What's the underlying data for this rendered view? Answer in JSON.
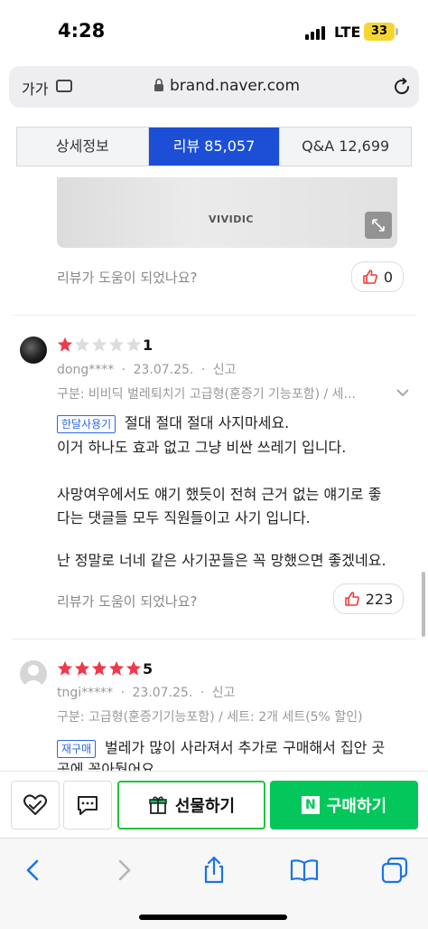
{
  "status_bar": {
    "time": "4:28",
    "network": "LTE",
    "battery": "33"
  },
  "address_bar": {
    "text_size": "가가",
    "url": "brand.naver.com"
  },
  "tabs": [
    {
      "label": "상세정보"
    },
    {
      "label": "리뷰  85,057"
    },
    {
      "label": "Q&A  12,699"
    }
  ],
  "photo": {
    "brand_text": "VIVIDIC"
  },
  "helpful_prompt": "리뷰가 도움이 되었나요?",
  "reviews": [
    {
      "rating": "1",
      "user": "dong****",
      "date": "23.07.25.",
      "report": "신고",
      "options": "구분: 비비딕 벌레퇴치기 고급형(훈증기 기능포함) / 세...",
      "badge": "한달사용기",
      "body_line1": "절대 절대 절대 사지마세요.",
      "body_line2": "이거 하나도 효과 없고 그냥 비싼 쓰레기 입니다.",
      "body_line3": "사망여우에서도 얘기 했듯이 전혀 근거 없는 얘기로 좋",
      "body_line4": "다는 댓글들 모두 직원들이고 사기 입니다.",
      "body_line5": "난 정말로 너네 같은 사기꾼들은 꼭 망했으면 좋겠네요.",
      "likes": "223"
    },
    {
      "rating": "5",
      "user": "tngi*****",
      "date": "23.07.25.",
      "report": "신고",
      "options": "구분: 고급형(훈증기기능포함) / 세트: 2개 세트(5% 할인)",
      "badge": "재구매",
      "body_line1": "벌레가 많이 사라져서 추가로 구매해서 집안 곳",
      "body_line2": "곳에 꽂아뒀어요..."
    }
  ],
  "prev_review_likes": "0",
  "actions": {
    "gift_label": "선물하기",
    "buy_label": "구매하기",
    "buy_logo": "N"
  },
  "colors": {
    "naver_green": "#03c75a",
    "tab_active": "#1c4fd6",
    "star_red": "#f0384a",
    "like_red": "#ef3a3a"
  }
}
